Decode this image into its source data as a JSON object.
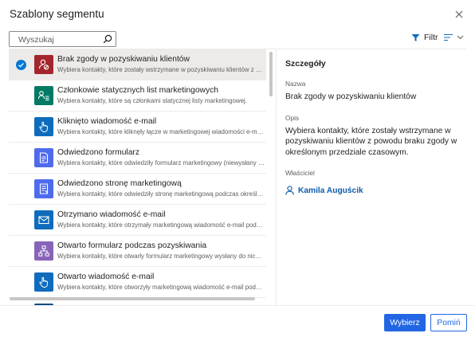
{
  "dialog": {
    "title": "Szablony segmentu"
  },
  "search": {
    "placeholder": "Wyszukaj",
    "value": ""
  },
  "toolbar": {
    "filter_label": "Filtr"
  },
  "templates": [
    {
      "title": "Brak zgody w pozyskiwaniu klientów",
      "description": "Wybiera kontakty, które zostały wstrzymane w pozyskiwaniu klientów z powod...",
      "color": "#a4262c",
      "icon": "blocked-person-icon",
      "selected": true
    },
    {
      "title": "Członkowie statycznych list marketingowych",
      "description": "Wybiera kontakty, które są członkami statycznej listy marketingowej.",
      "color": "#037a64",
      "icon": "people-list-icon",
      "selected": false
    },
    {
      "title": "Kliknięto wiadomość e-mail",
      "description": "Wybiera kontakty, które kliknęły łącze w marketingowej wiadomości e-mail po...",
      "color": "#0f6cbd",
      "icon": "pointer-hand-icon",
      "selected": false
    },
    {
      "title": "Odwiedzono formularz",
      "description": "Wybiera kontakty, które odwiedziły formularz marketingowy (niewysłany do nic...",
      "color": "#4f6bed",
      "icon": "form-icon",
      "selected": false
    },
    {
      "title": "Odwiedzono stronę marketingową",
      "description": "Wybiera kontakty, które odwiedziły stronę marketingową podczas określonego...",
      "color": "#4f6bed",
      "icon": "page-icon",
      "selected": false
    },
    {
      "title": "Otrzymano wiadomość e-mail",
      "description": "Wybiera kontakty, które otrzymały marketingową wiadomość e-mail podczas ok...",
      "color": "#0f6cbd",
      "icon": "envelope-icon",
      "selected": false
    },
    {
      "title": "Otwarto formularz podczas pozyskiwania",
      "description": "Wybiera kontakty, które otwarły formularz marketingowy wysłany do nich prze...",
      "color": "#8764b8",
      "icon": "flowchart-icon",
      "selected": false
    },
    {
      "title": "Otwarto wiadomość e-mail",
      "description": "Wybiera kontakty, które otworzyły marketingową wiadomość e-mail podczas ok...",
      "color": "#0f6cbd",
      "icon": "pointer-hand-icon",
      "selected": false
    },
    {
      "title": "",
      "description": "",
      "color": "#0f4a85",
      "icon": "mail-icon",
      "selected": false
    }
  ],
  "details": {
    "heading": "Szczegóły",
    "name_label": "Nazwa",
    "name_value": "Brak zgody w pozyskiwaniu klientów",
    "description_label": "Opis",
    "description_value": "Wybiera kontakty, które zostały wstrzymane w pozyskiwaniu klientów z powodu braku zgody w określonym przedziale czasowym.",
    "owner_label": "Właściciel",
    "owner_name": "Kamila Auguścik"
  },
  "actions": {
    "select_label": "Wybierz",
    "skip_label": "Pomiń"
  },
  "colors": {
    "accent": "#2266e3",
    "link": "#0f5ba8",
    "selected_row": "#edebe9"
  }
}
